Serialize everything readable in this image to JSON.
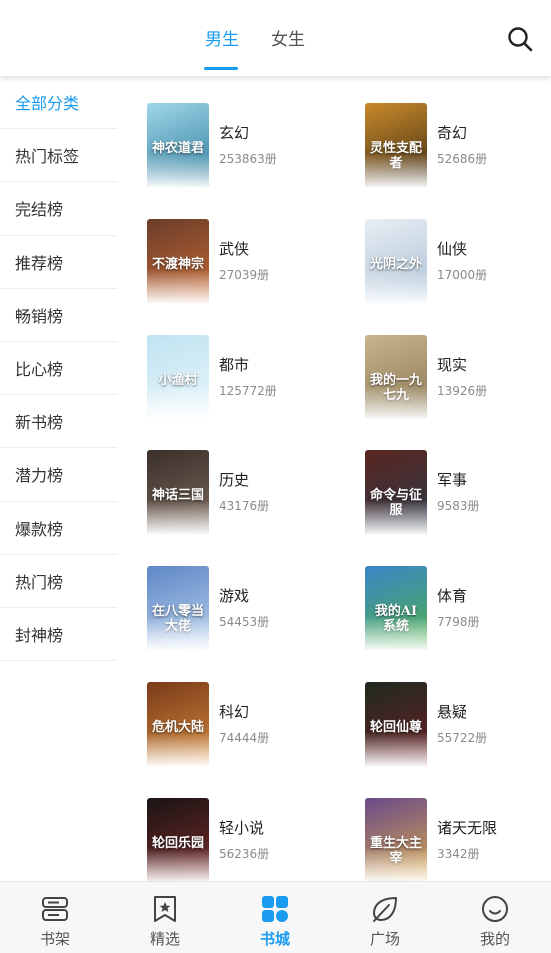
{
  "header": {
    "tabs": [
      {
        "label": "男生",
        "active": true
      },
      {
        "label": "女生",
        "active": false
      }
    ],
    "search_icon": "search-icon",
    "accent_color": "#1a9bf0"
  },
  "sidebar": {
    "items": [
      {
        "label": "全部分类",
        "active": true
      },
      {
        "label": "热门标签"
      },
      {
        "label": "完结榜"
      },
      {
        "label": "推荐榜"
      },
      {
        "label": "畅销榜"
      },
      {
        "label": "比心榜"
      },
      {
        "label": "新书榜"
      },
      {
        "label": "潜力榜"
      },
      {
        "label": "爆款榜"
      },
      {
        "label": "热门榜"
      },
      {
        "label": "封神榜"
      }
    ]
  },
  "categories": [
    {
      "name": "玄幻",
      "count": "253863册",
      "cover_text": "神农道君",
      "cover_colors": [
        "#9fd6e8",
        "#2b7a9a"
      ]
    },
    {
      "name": "奇幻",
      "count": "52686册",
      "cover_text": "灵性支配者",
      "cover_colors": [
        "#c98a2a",
        "#3a2a14"
      ]
    },
    {
      "name": "武侠",
      "count": "27039册",
      "cover_text": "不渡神宗",
      "cover_colors": [
        "#6a3d2a",
        "#c96a34"
      ]
    },
    {
      "name": "仙侠",
      "count": "17000册",
      "cover_text": "光阴之外",
      "cover_colors": [
        "#e8eef4",
        "#a9c0d4"
      ]
    },
    {
      "name": "都市",
      "count": "125772册",
      "cover_text": "小渔村",
      "cover_colors": [
        "#bfe3f1",
        "#e9f6fb"
      ]
    },
    {
      "name": "现实",
      "count": "13926册",
      "cover_text": "我的一九七九",
      "cover_colors": [
        "#c7b58d",
        "#8a7654"
      ]
    },
    {
      "name": "历史",
      "count": "43176册",
      "cover_text": "神话三国",
      "cover_colors": [
        "#3a2f2a",
        "#7d6b5d"
      ]
    },
    {
      "name": "军事",
      "count": "9583册",
      "cover_text": "命令与征服",
      "cover_colors": [
        "#5a2620",
        "#2a3a4a"
      ]
    },
    {
      "name": "游戏",
      "count": "54453册",
      "cover_text": "在八零当大佬",
      "cover_colors": [
        "#5f87c6",
        "#b9d2ee"
      ]
    },
    {
      "name": "体育",
      "count": "7798册",
      "cover_text": "我的AI系统",
      "cover_colors": [
        "#3a86c8",
        "#4fb04a"
      ]
    },
    {
      "name": "科幻",
      "count": "74444册",
      "cover_text": "危机大陆",
      "cover_colors": [
        "#7a3a1a",
        "#d48a3a"
      ]
    },
    {
      "name": "悬疑",
      "count": "55722册",
      "cover_text": "轮回仙尊",
      "cover_colors": [
        "#1f2a20",
        "#6a1f24"
      ]
    },
    {
      "name": "轻小说",
      "count": "56236册",
      "cover_text": "轮回乐园",
      "cover_colors": [
        "#1a1414",
        "#7a2a2a"
      ]
    },
    {
      "name": "诸天无限",
      "count": "3342册",
      "cover_text": "重生大主宰",
      "cover_colors": [
        "#6a4a8a",
        "#d9a94a"
      ]
    }
  ],
  "bottom_nav": [
    {
      "label": "书架",
      "icon": "bookshelf-icon",
      "active": false
    },
    {
      "label": "精选",
      "icon": "star-bookmark-icon",
      "active": false
    },
    {
      "label": "书城",
      "icon": "grid-apps-icon",
      "active": true
    },
    {
      "label": "广场",
      "icon": "leaf-icon",
      "active": false
    },
    {
      "label": "我的",
      "icon": "smile-face-icon",
      "active": false
    }
  ]
}
